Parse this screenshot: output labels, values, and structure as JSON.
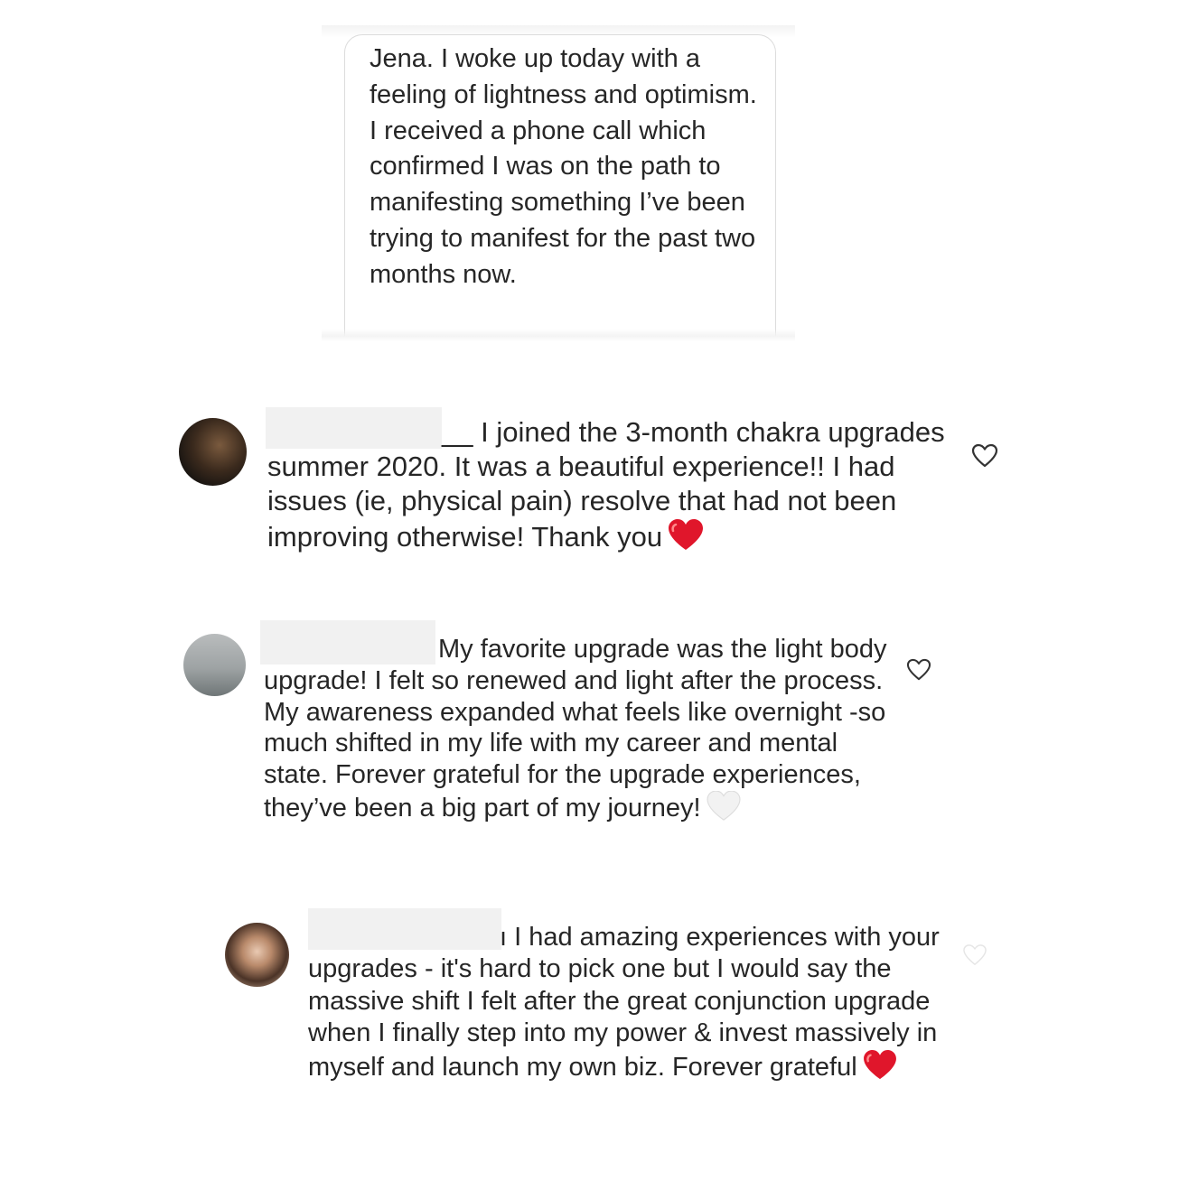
{
  "message": {
    "text": "Jena. I woke up today with a feeling of lightness and optimism. I received a phone call which confirmed I was on the path to manifesting something I’ve been trying to manifest for the past two months now."
  },
  "comments": [
    {
      "prefix": "__",
      "text": "I joined the 3-month chakra upgrades summer 2020. It was a beautiful experience!! I had issues (ie, physical pain) resolve that had not been improving otherwise! Thank you",
      "emoji": "red-heart",
      "like_icon": "heart-outline-icon"
    },
    {
      "prefix": "",
      "text": "My favorite upgrade was the light body upgrade! I felt so renewed and light after the process.  My awareness expanded what feels like overnight -so much shifted in my life with my career and mental state. Forever grateful for the upgrade experiences, they’ve been a big part of my journey!",
      "emoji": "white-heart",
      "like_icon": "heart-outline-icon"
    },
    {
      "prefix": "ı",
      "text": "I had amazing experiences with your upgrades - it's hard to pick one but I would say the massive shift I felt after the great conjunction upgrade when I finally step into my power & invest massively in myself and launch my own biz. Forever grateful",
      "emoji": "red-heart",
      "like_icon": "heart-outline-icon"
    }
  ],
  "colors": {
    "text": "#262626",
    "redaction": "#f1f1f1",
    "red_heart": "#e0162b",
    "white_heart": "#f2f2f2"
  }
}
